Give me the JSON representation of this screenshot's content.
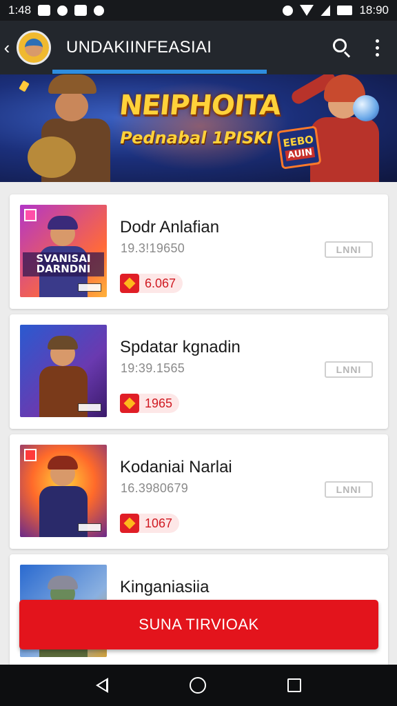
{
  "status_bar": {
    "left_time": "1:48",
    "left_icons": [
      "photo-icon",
      "chat-icon",
      "mail-icon",
      "circle-icon"
    ],
    "right_icons": [
      "alarm-icon",
      "wifi-icon",
      "signal-icon",
      "battery-icon"
    ],
    "right_time": "18:90"
  },
  "app_bar": {
    "back_glyph": "‹",
    "title": "UNDAKIINFEASIAI",
    "search_icon": "search-icon",
    "menu_icon": "more-vert-icon",
    "tab_indicator_color": "#2e8de0"
  },
  "banner": {
    "title": "NEIPHOITA",
    "subtitle": "Pednabal 1PISKI",
    "badge_line1": "EEBO",
    "badge_line2": "AUIN"
  },
  "list": {
    "items": [
      {
        "title": "Dodr Anlafian",
        "meta": "19.3!19650",
        "button": "LNNI",
        "price": "6.067",
        "thumb_caption": "SVANISAI DARNDNI"
      },
      {
        "title": "Spdatar kgnadin",
        "meta": "19:39.1565",
        "button": "LNNI",
        "price": "1965",
        "thumb_caption": ""
      },
      {
        "title": "Kodaniai Narlai",
        "meta": "16.3980679",
        "button": "LNNI",
        "price": "1067",
        "thumb_caption": ""
      },
      {
        "title": "Kinganiasiia",
        "meta": "",
        "button": "",
        "price": "",
        "thumb_caption": ""
      }
    ]
  },
  "cta": {
    "label": "SUNA TIRVIOAK",
    "color": "#e3141c"
  },
  "nav_bar": {
    "back_icon": "nav-back-icon",
    "home_icon": "nav-home-icon",
    "recents_icon": "nav-recents-icon"
  }
}
